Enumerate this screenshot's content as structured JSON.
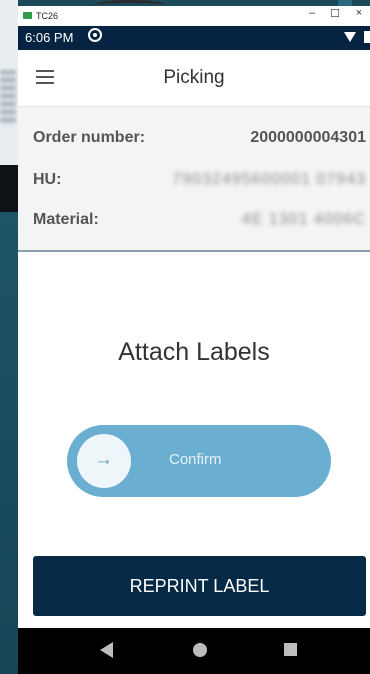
{
  "window": {
    "app_name": "TC26",
    "minimize": "–",
    "maximize": "☐",
    "close": "×"
  },
  "status_bar": {
    "time": "6:06 PM"
  },
  "app_bar": {
    "title": "Picking"
  },
  "order": {
    "order_label": "Order number:",
    "order_value": "2000000004301",
    "hu_label": "HU:",
    "hu_value": "79032495600001 07943",
    "material_label": "Material:",
    "material_value": "4E 1301 4006C"
  },
  "main": {
    "heading": "Attach Labels",
    "confirm_label": "Confirm",
    "confirm_arrow": "→",
    "reprint_label": "REPRINT LABEL"
  },
  "colors": {
    "status_bar": "#062441",
    "slider": "#6aaed1",
    "reprint_button": "#062a46"
  },
  "icons": {
    "menu": "hamburger-icon",
    "status": "sync-icon",
    "wifi": "wifi-icon",
    "battery": "battery-icon",
    "back": "back-icon",
    "home": "home-icon",
    "recent": "recent-apps-icon"
  }
}
